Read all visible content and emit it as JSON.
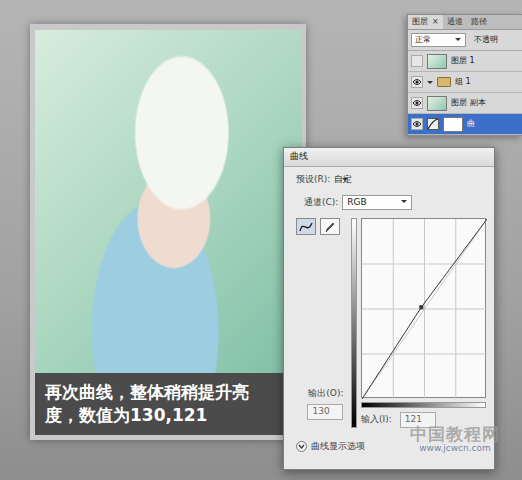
{
  "layers_panel": {
    "tabs": [
      {
        "label": "图层",
        "selected": true
      },
      {
        "label": "通道",
        "selected": false
      },
      {
        "label": "路径",
        "selected": false
      }
    ],
    "close": "×",
    "blend_mode": "正常",
    "opacity_label": "不透明",
    "layers": [
      {
        "name": "图层 1",
        "kind": "layer",
        "visible": false,
        "selected": false,
        "expanded": false
      },
      {
        "name": "组 1",
        "kind": "group",
        "visible": true,
        "selected": false,
        "expanded": true
      },
      {
        "name": "图层 副本",
        "kind": "layer",
        "visible": true,
        "selected": false,
        "expanded": false
      },
      {
        "name": "曲",
        "kind": "adjustment",
        "visible": true,
        "selected": true,
        "expanded": false
      }
    ]
  },
  "curves_dialog": {
    "title": "曲线",
    "preset_label": "预设(R):",
    "preset": "自定",
    "channel_label": "通道(C):",
    "channel": "RGB",
    "tools": [
      {
        "tool": "curve",
        "selected": true
      },
      {
        "tool": "pencil",
        "selected": false
      }
    ],
    "output_label": "输出(O):",
    "output": "130",
    "input_label": "输入(I):",
    "input": "121",
    "point": {
      "input": 121,
      "output": 130
    },
    "show_options": "曲线显示选项",
    "options_expanded": false
  },
  "caption": "再次曲线，整体稍稍提升亮度，数值为130,121",
  "watermark": {
    "name": "中国教程网",
    "url": "www.jcwcn.com"
  }
}
